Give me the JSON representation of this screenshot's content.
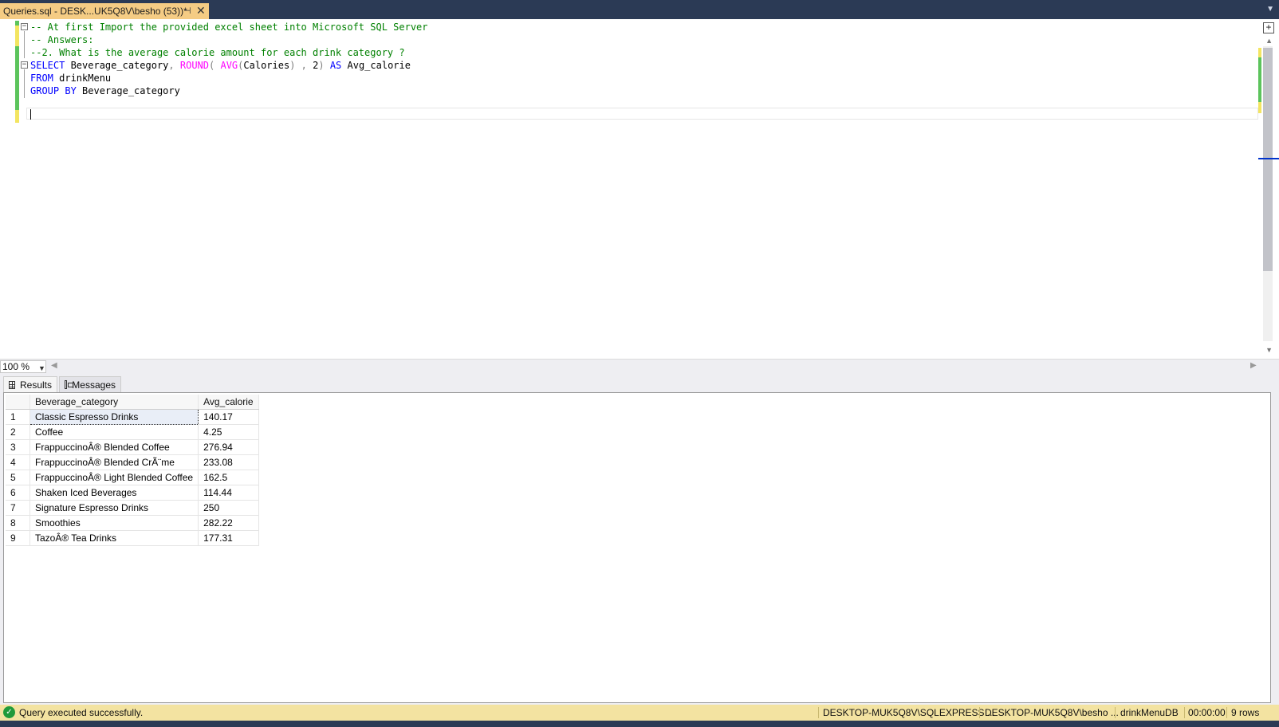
{
  "document_tab": {
    "title": "Queries.sql - DESK...UK5Q8V\\besho (53))*",
    "pin_icon": "pin-icon",
    "close_icon": "close-icon"
  },
  "editor": {
    "lines": [
      {
        "tokens": [
          {
            "t": "-- At first Import the provided excel sheet into Microsoft SQL Server",
            "c": "cmt"
          }
        ]
      },
      {
        "tokens": [
          {
            "t": "-- Answers:",
            "c": "cmt"
          }
        ]
      },
      {
        "tokens": [
          {
            "t": "--2. What is the average calorie amount for each drink category ?",
            "c": "cmt"
          }
        ]
      },
      {
        "tokens": [
          {
            "t": "SELECT",
            "c": "kw"
          },
          {
            "t": " Beverage_category",
            "c": "txt"
          },
          {
            "t": ",",
            "c": "gray"
          },
          {
            "t": " ",
            "c": "txt"
          },
          {
            "t": "ROUND",
            "c": "fn"
          },
          {
            "t": "(",
            "c": "gray"
          },
          {
            "t": " ",
            "c": "txt"
          },
          {
            "t": "AVG",
            "c": "fn"
          },
          {
            "t": "(",
            "c": "gray"
          },
          {
            "t": "Calories",
            "c": "txt"
          },
          {
            "t": ")",
            "c": "gray"
          },
          {
            "t": " ",
            "c": "txt"
          },
          {
            "t": ",",
            "c": "gray"
          },
          {
            "t": " 2",
            "c": "txt"
          },
          {
            "t": ")",
            "c": "gray"
          },
          {
            "t": " ",
            "c": "txt"
          },
          {
            "t": "AS",
            "c": "kw"
          },
          {
            "t": " Avg_calorie",
            "c": "txt"
          }
        ]
      },
      {
        "tokens": [
          {
            "t": "FROM",
            "c": "kw"
          },
          {
            "t": " drinkMenu",
            "c": "txt"
          }
        ]
      },
      {
        "tokens": [
          {
            "t": "GROUP BY",
            "c": "kw"
          },
          {
            "t": " Beverage_category",
            "c": "txt"
          }
        ]
      },
      {
        "tokens": []
      },
      {
        "tokens": []
      }
    ]
  },
  "zoom": {
    "value": "100 %"
  },
  "results_tabs": [
    {
      "label": "Results",
      "icon": "grid-icon",
      "active": true
    },
    {
      "label": "Messages",
      "icon": "messages-icon",
      "active": false
    }
  ],
  "results": {
    "columns": [
      "Beverage_category",
      "Avg_calorie"
    ],
    "rows": [
      {
        "n": "1",
        "category": "Classic Espresso Drinks",
        "avg": "140.17"
      },
      {
        "n": "2",
        "category": "Coffee",
        "avg": "4.25"
      },
      {
        "n": "3",
        "category": "FrappuccinoÂ® Blended Coffee",
        "avg": "276.94"
      },
      {
        "n": "4",
        "category": "FrappuccinoÂ® Blended CrÃ¨me",
        "avg": "233.08"
      },
      {
        "n": "5",
        "category": "FrappuccinoÂ® Light Blended Coffee",
        "avg": "162.5"
      },
      {
        "n": "6",
        "category": "Shaken Iced Beverages",
        "avg": "114.44"
      },
      {
        "n": "7",
        "category": "Signature Espresso Drinks",
        "avg": "250"
      },
      {
        "n": "8",
        "category": "Smoothies",
        "avg": "282.22"
      },
      {
        "n": "9",
        "category": "TazoÂ® Tea Drinks",
        "avg": "177.31"
      }
    ]
  },
  "status": {
    "message": "Query executed successfully.",
    "server": "DESKTOP-MUK5Q8V\\SQLEXPRESS ...",
    "user": "DESKTOP-MUK5Q8V\\besho ...",
    "database": "drinkMenuDB",
    "elapsed": "00:00:00",
    "rows": "9 rows"
  },
  "colors": {
    "tab_active": "#f5cc84",
    "status_bar": "#f3e3a1",
    "chrome": "#2b3a55",
    "success": "#1f9a3a"
  }
}
